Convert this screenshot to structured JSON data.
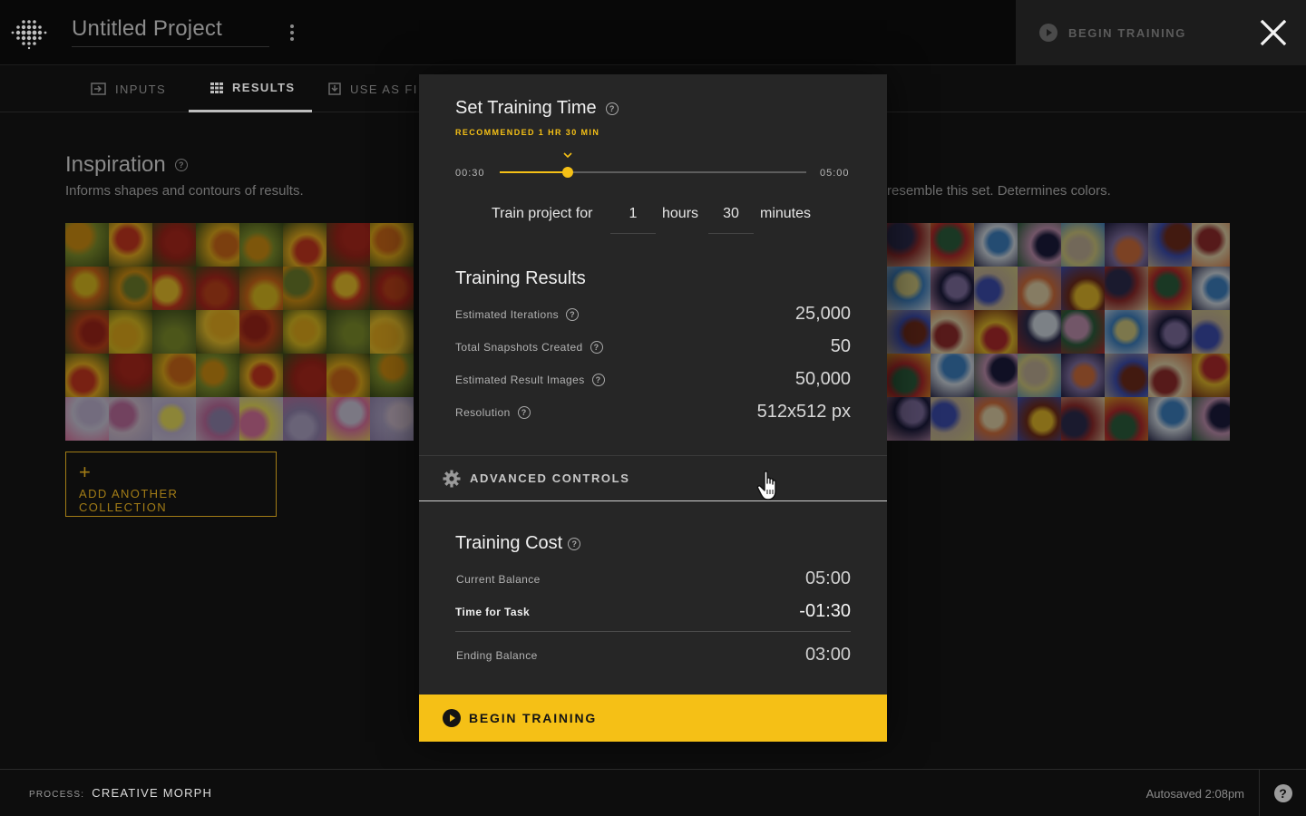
{
  "header": {
    "project_title": "Untitled Project",
    "begin_training_label": "BEGIN TRAINING",
    "close_icon": "close-icon",
    "menu_icon": "kebab-menu-icon"
  },
  "tabs": [
    {
      "label": "INPUTS",
      "icon": "inputs-icon",
      "active": false
    },
    {
      "label": "RESULTS",
      "icon": "grid-icon",
      "active": true
    },
    {
      "label": "USE AS FI",
      "icon": "export-icon",
      "active": false
    }
  ],
  "background": {
    "inspiration_title": "Inspiration",
    "inspiration_subtitle": "Informs shapes and contours of results.",
    "right_subtitle": "resemble this set. Determines colors.",
    "add_collection_label": "ADD ANOTHER COLLECTION",
    "add_collection_plus": "+"
  },
  "modal": {
    "title": "Set Training Time",
    "recommended": "RECOMMENDED 1 HR 30 MIN",
    "slider": {
      "min_label": "00:30",
      "max_label": "05:00",
      "value_fraction": 0.2222,
      "recommended_fraction": 0.2222
    },
    "train_for": {
      "prefix": "Train project for",
      "hours_value": "1",
      "hours_label": "hours",
      "minutes_value": "30",
      "minutes_label": "minutes"
    },
    "results_title": "Training Results",
    "results": [
      {
        "label": "Estimated Iterations",
        "value": "25,000"
      },
      {
        "label": "Total Snapshots Created",
        "value": "50"
      },
      {
        "label": "Estimated Result Images",
        "value": "50,000"
      },
      {
        "label": "Resolution",
        "value": "512x512 px"
      }
    ],
    "advanced_label": "ADVANCED CONTROLS",
    "cost_title": "Training Cost",
    "cost": {
      "current_balance_label": "Current Balance",
      "current_balance_value": "05:00",
      "time_for_task_label": "Time for Task",
      "time_for_task_value": "-01:30",
      "ending_balance_label": "Ending Balance",
      "ending_balance_value": "03:00"
    },
    "begin_label": "BEGIN TRAINING"
  },
  "footer": {
    "process_key": "PROCESS:",
    "process_value": "CREATIVE MORPH",
    "autosaved": "Autosaved 2:08pm",
    "help_glyph": "?"
  },
  "colors": {
    "accent": "#f5c016",
    "modal_bg": "#262626",
    "page_bg": "#0d0d0d"
  }
}
